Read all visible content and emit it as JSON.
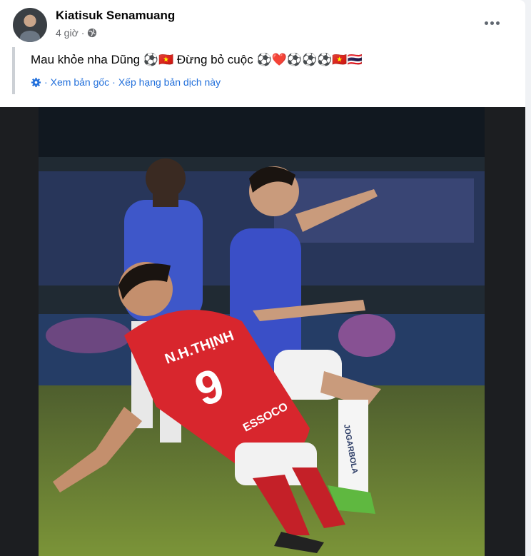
{
  "post": {
    "author": "Kiatisuk Senamuang",
    "time": "4 giờ",
    "text": "Mau khỏe nha Dũng ⚽🇻🇳 Đừng bỏ cuộc ⚽❤️⚽⚽⚽🇻🇳🇹🇭",
    "see_original": "Xem bản gốc",
    "rate_translation": "Xếp hạng bản dịch này",
    "separator": "·"
  },
  "photo": {
    "jersey_name": "N.H.THỊNH",
    "jersey_number": "9",
    "sponsor": "ESSOCO",
    "sock_text": "JOGARBOLA"
  },
  "colors": {
    "link": "#216fdb",
    "meta": "#65676b"
  },
  "icons": [
    "globe-icon",
    "more-options-icon",
    "translate-settings-icon"
  ]
}
